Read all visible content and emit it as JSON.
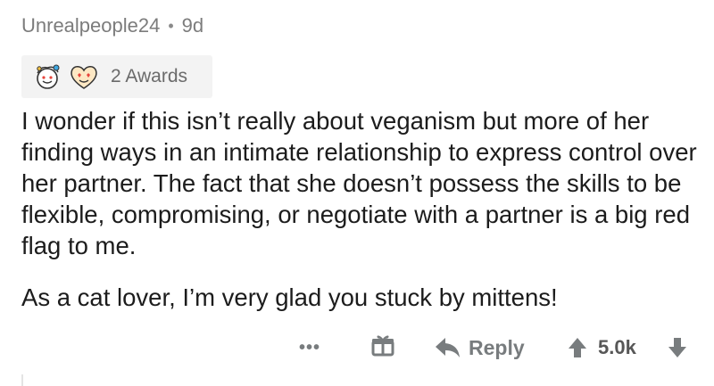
{
  "comment": {
    "author": "Unrealpeople24",
    "separator": "•",
    "age": "9d",
    "awards": {
      "label": "2 Awards",
      "icons": [
        "wholesome-award-icon",
        "heart-eyes-award-icon"
      ]
    },
    "paragraphs": [
      "I wonder if this isn’t really about veganism but more of her finding ways in an intimate relationship to express control over her partner. The fact that she doesn’t possess the skills to be flexible, compromising, or negotiate with a partner is a big red flag to me.",
      "As a cat lover, I’m very glad you stuck by mittens!"
    ]
  },
  "actions": {
    "more_label": "•••",
    "gift_icon": "gift-icon",
    "reply_label": "Reply",
    "score": "5.0k"
  },
  "colors": {
    "meta_text": "#7c7c7c",
    "body_text": "#1c1c1c",
    "action_gray": "#787c7e",
    "award_bg": "#f3f3f3"
  }
}
